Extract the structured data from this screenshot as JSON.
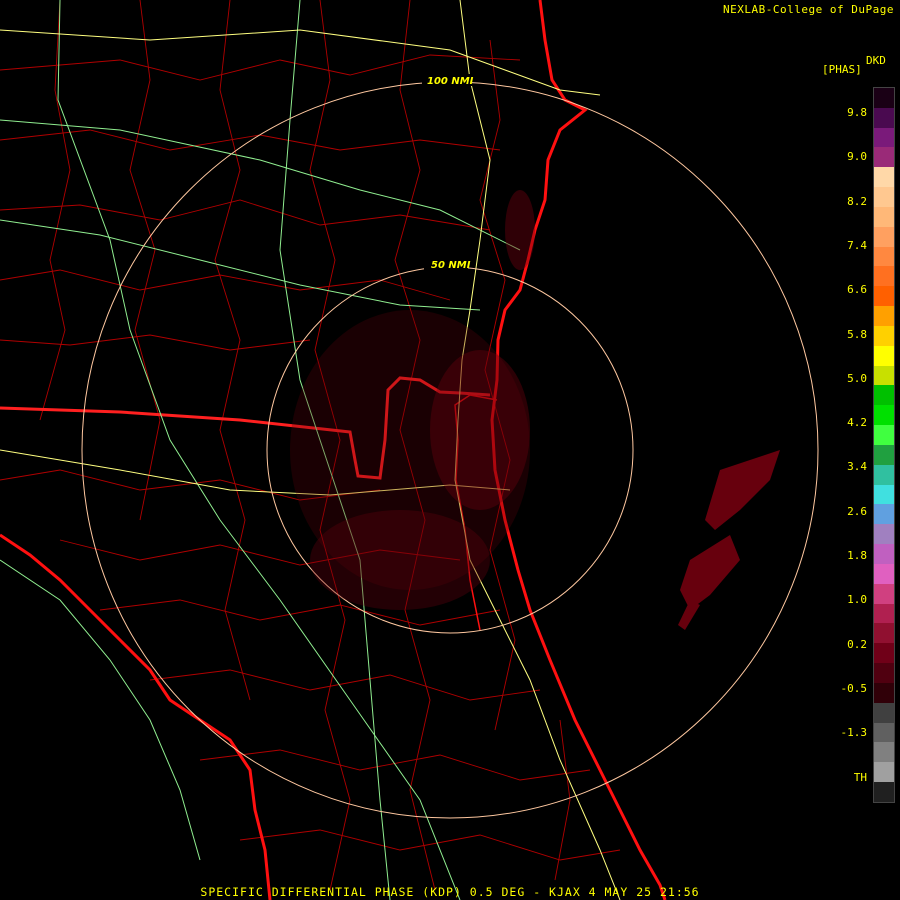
{
  "header": {
    "credit": "NEXLAB-College of DuPage",
    "product_code": "DKD",
    "unit": "[PHAS]"
  },
  "footer": {
    "caption": "SPECIFIC DIFFERENTIAL PHASE (KDP) 0.5 DEG - KJAX 4 MAY 25 21:56"
  },
  "range_rings": {
    "inner_label": "50 NMI",
    "outer_label": "100 NMI"
  },
  "legend": {
    "ticks": [
      "9.8",
      "9.0",
      "8.2",
      "7.4",
      "6.6",
      "5.8",
      "5.0",
      "4.2",
      "3.4",
      "2.6",
      "1.8",
      "1.0",
      "0.2",
      "-0.5",
      "-1.3",
      "TH"
    ],
    "colors": [
      "#1a0015",
      "#4a0a50",
      "#7a1a7a",
      "#9a2a78",
      "#ffd8a8",
      "#ffc890",
      "#ffb878",
      "#ffa060",
      "#ff8840",
      "#ff7020",
      "#ff6000",
      "#ffa000",
      "#ffd000",
      "#ffff00",
      "#c8e000",
      "#00c000",
      "#00e000",
      "#40ff40",
      "#20a040",
      "#30c0a0",
      "#40e0e0",
      "#60a0e0",
      "#a080c0",
      "#c060c0",
      "#e060c0",
      "#d04080",
      "#b02050",
      "#901030",
      "#700018",
      "#500010",
      "#300008",
      "#404040",
      "#606060",
      "#808080",
      "#a0a0a0",
      "#202020"
    ],
    "accent_border": "#ff0000",
    "road_color": "#90ee90",
    "highway_color": "#ffff80"
  },
  "map_colors": {
    "county": "#cc0000",
    "state": "#ff2020",
    "coast": "#ff1010",
    "ring": "#ffc8a0",
    "echo": "#800010"
  }
}
